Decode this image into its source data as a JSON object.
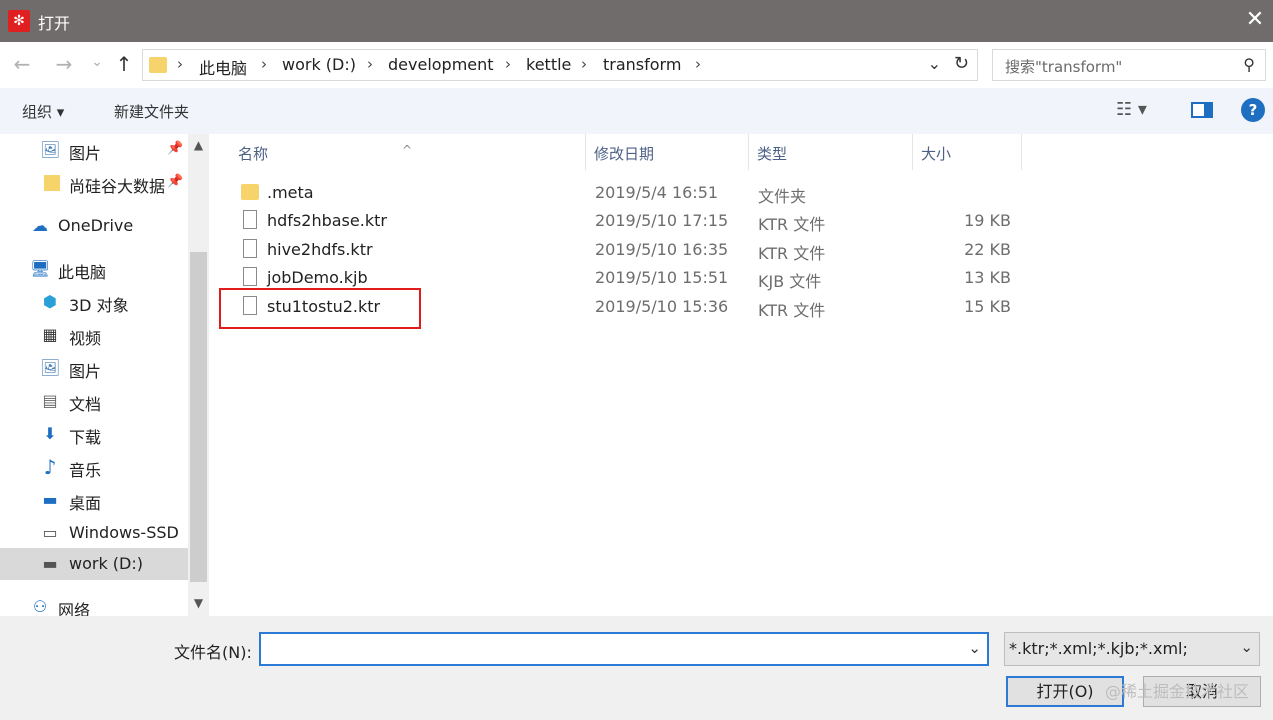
{
  "window": {
    "title": "打开",
    "app_icon": "kettle-app-icon",
    "close_glyph": "✕"
  },
  "nav": {
    "back_glyph": "←",
    "forward_glyph": "→",
    "recent_glyph": "⌄",
    "up_glyph": "↑",
    "breadcrumbs": [
      "此电脑",
      "work (D:)",
      "development",
      "kettle",
      "transform"
    ],
    "separator": "›",
    "dropdown_glyph": "⌄",
    "refresh_glyph": "↻",
    "search_placeholder": "搜索\"transform\"",
    "search_glyph": "⚲"
  },
  "toolbar": {
    "organize_label": "组织 ▾",
    "new_folder_label": "新建文件夹",
    "view_glyph": "☷ ▾",
    "help_glyph": "?"
  },
  "sidebar": {
    "items": [
      {
        "label": "图片",
        "icon": "🖼",
        "pinned": true
      },
      {
        "label": "尚硅谷大数据",
        "icon": "folder",
        "pinned": true
      },
      {
        "label": "OneDrive",
        "icon": "☁"
      },
      {
        "label": "此电脑",
        "icon": "🖥"
      },
      {
        "label": "3D 对象",
        "icon": "⬢"
      },
      {
        "label": "视频",
        "icon": "▦"
      },
      {
        "label": "图片",
        "icon": "🖼"
      },
      {
        "label": "文档",
        "icon": "▤"
      },
      {
        "label": "下载",
        "icon": "⬇"
      },
      {
        "label": "音乐",
        "icon": "♪"
      },
      {
        "label": "桌面",
        "icon": "▬"
      },
      {
        "label": "Windows-SSD",
        "icon": "▭"
      },
      {
        "label": "work (D:)",
        "icon": "▬",
        "selected": true
      },
      {
        "label": "网络",
        "icon": "⚇"
      }
    ],
    "pin_glyph": "📌",
    "scroll_up": "▲",
    "scroll_down": "▼"
  },
  "filelist": {
    "sort_glyph": "^",
    "columns": {
      "name": "名称",
      "date": "修改日期",
      "type": "类型",
      "size": "大小"
    },
    "rows": [
      {
        "name": ".meta",
        "date": "2019/5/4 16:51",
        "type": "文件夹",
        "size": "",
        "kind": "folder"
      },
      {
        "name": "hdfs2hbase.ktr",
        "date": "2019/5/10 17:15",
        "type": "KTR 文件",
        "size": "19 KB",
        "kind": "file"
      },
      {
        "name": "hive2hdfs.ktr",
        "date": "2019/5/10 16:35",
        "type": "KTR 文件",
        "size": "22 KB",
        "kind": "file"
      },
      {
        "name": "jobDemo.kjb",
        "date": "2019/5/10 15:51",
        "type": "KJB 文件",
        "size": "13 KB",
        "kind": "file"
      },
      {
        "name": "stu1tostu2.ktr",
        "date": "2019/5/10 15:36",
        "type": "KTR 文件",
        "size": "15 KB",
        "kind": "file"
      }
    ]
  },
  "bottom": {
    "filename_label": "文件名(N):",
    "filename_value": "",
    "dropdown_glyph": "⌄",
    "filter_value": "*.ktr;*.xml;*.kjb;*.xml;",
    "open_button": "打开(O)",
    "cancel_button": "取消",
    "watermark": "@稀土掘金技术社区"
  },
  "colors": {
    "titlebar": "#6f6c6b",
    "accent": "#2d7ad6",
    "highlight": "#e21b1b",
    "folder": "#f7d36c"
  }
}
